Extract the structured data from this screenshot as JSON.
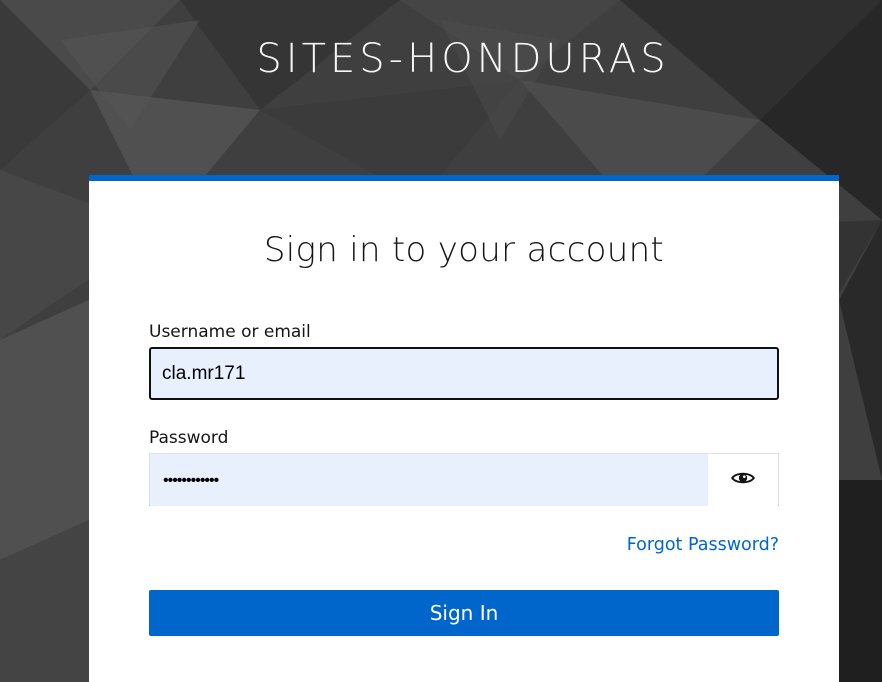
{
  "realm": {
    "title": "SITES-HONDURAS"
  },
  "login_card": {
    "title": "Sign in to your account",
    "username": {
      "label": "Username or email",
      "value": "cla.mr171"
    },
    "password": {
      "label": "Password",
      "masked_value": "••••••••••••",
      "reveal_icon": "eye-icon"
    },
    "forgot_password_label": "Forgot Password?",
    "sign_in_label": "Sign In"
  },
  "colors": {
    "accent": "#0066cc",
    "input_autofill_bg": "#e8f0fe",
    "background_dark": "#3d3d3d"
  }
}
